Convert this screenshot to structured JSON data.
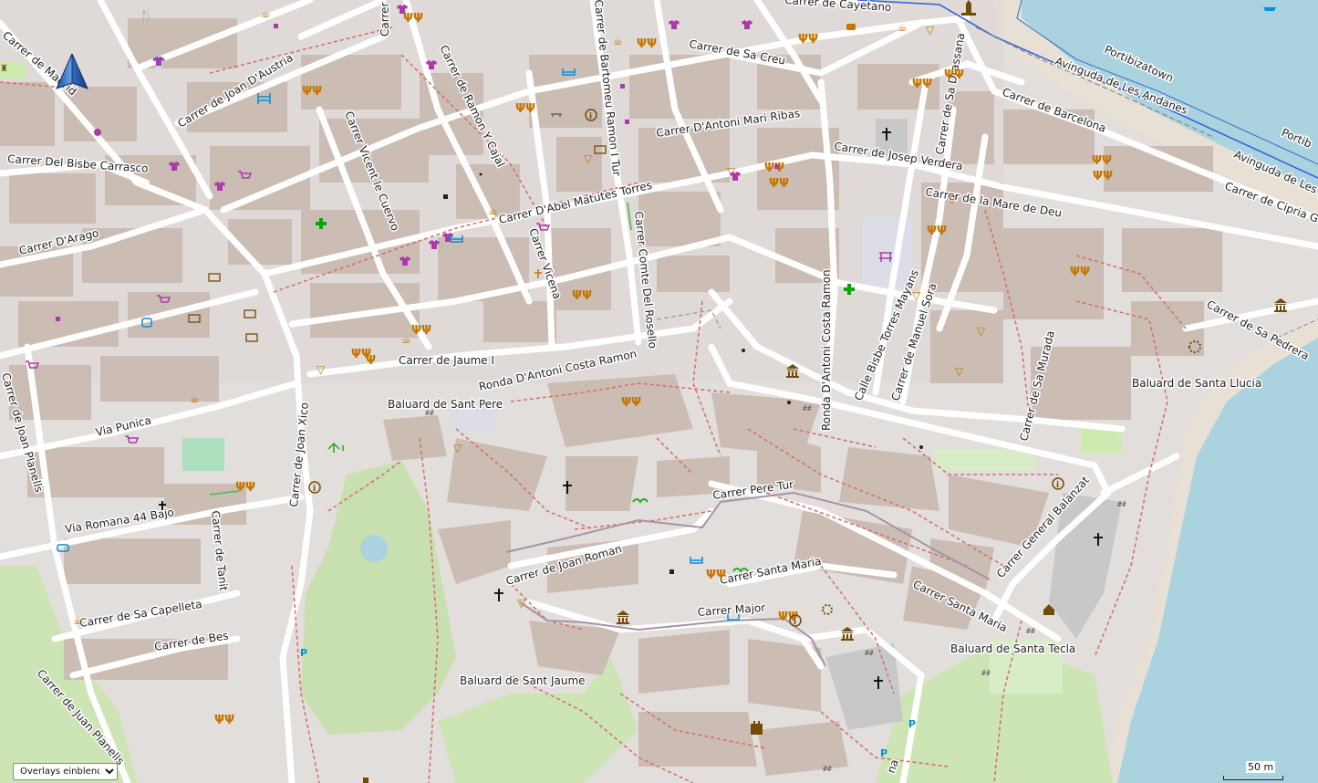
{
  "map": {
    "colors": {
      "background": "#e2dedb",
      "building": "#cbbdb3",
      "block": "#d9d4d0",
      "road": "#ffffff",
      "water": "#aad3df",
      "park": "#c8dfb0",
      "grass": "#cdebb0",
      "path": "#d67070",
      "boundary": "#3366dd",
      "pedestrian": "#dddde8",
      "shore": "#e8e0d4",
      "food": "#c77400",
      "shop": "#ac39ac",
      "tourism": "#734a08",
      "religion": "#000000",
      "health": "#00aa00",
      "transport": "#0092da"
    },
    "street_labels": [
      "Carrer de Madrid",
      "Carrer de Joan D'Austria",
      "Carrer Del Bisbe Carrasco",
      "Carrer D'Arago",
      "Carrer Vicent le Cuervo",
      "Carrer de Ramon Y Cajal",
      "Carrer de Bartomeu Ramon I Tur",
      "Carrer de Sa Creu",
      "Carrer D'Antoni Mari Ribas",
      "Carrer D'Abel Matutes Torres",
      "Carrer Comte Del Rosello",
      "Carrer Vicena",
      "Carrer de Jaume I",
      "Ronda D'Antoni Costa Ramon",
      "Baluard de Sant Pere",
      "Via Punica",
      "Carrer de Joan Xico",
      "Carrer de Joan Planells",
      "Via Romana 44 Bajo",
      "Carrer de Tanit",
      "Carrer de Sa Capelleta",
      "Carrer de Bes",
      "Carrer de Juan Planells",
      "Baluard de Sant Jaume",
      "Carrer de Joan Roman",
      "Carrer Pere Tur",
      "Carrer Santa Maria",
      "Carrer Major",
      "Carrer Santa Maria",
      "Baluard de Santa Tecla",
      "Carrer General Balanzat",
      "Ronda D'Antoni Costa Ramon",
      "Calle Bisbe Torres Mayans",
      "Carrer de Manuel Sora",
      "Carrer de Josep Verdera",
      "Carrer de la Mare de Deu",
      "Carrer de Sa Drassana",
      "Carrer de Barcelona",
      "Avinguda de Les Andanes",
      "Portibizatown",
      "Avinguda de Les An",
      "Carrer de Cipria Ga",
      "Portib",
      "Carrer de Sa Pedrera",
      "Baluard de Santa Llucia",
      "Carrer de Sa Murada",
      "Carrer",
      "Carrer de Cayetano",
      "na"
    ],
    "icons": {
      "north": "north-arrow-icon",
      "restaurant": "fork-knife-icon",
      "cafe": "coffee-cup-icon",
      "fast_food": "burger-icon",
      "clothes": "tshirt-icon",
      "supermarket": "shopping-cart-icon",
      "pharmacy": "green-cross-icon",
      "church": "cross-icon",
      "museum": "museum-icon",
      "info": "info-icon",
      "bank": "banknote-icon",
      "hotel": "bed-icon",
      "parking": "parking-icon",
      "bus": "bus-icon",
      "ferry": "ferry-icon",
      "viewpoint": "viewpoint-icon",
      "castle": "castle-icon",
      "marketplace": "marketplace-icon",
      "apple": "apple-icon",
      "pub": "beer-icon",
      "ice_cream": "ice-cream-icon"
    }
  },
  "controls": {
    "overlay_dropdown": "Overlays einblenden",
    "scale_label": "50 m"
  }
}
